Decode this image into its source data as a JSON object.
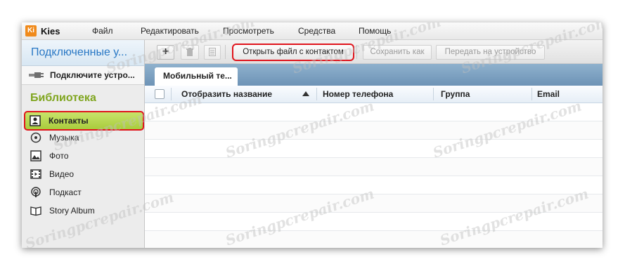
{
  "window": {
    "app_title": "Kies",
    "logo_text": "Ki"
  },
  "menu": [
    "Файл",
    "Редактировать",
    "Просмотреть",
    "Средства",
    "Помощь"
  ],
  "sidebar": {
    "connected_header": "Подключенные у...",
    "device_prompt": "Подключите устро...",
    "library_header": "Библиотека",
    "items": [
      {
        "label": "Контакты",
        "icon": "contacts-icon",
        "active": true
      },
      {
        "label": "Музыка",
        "icon": "music-icon",
        "active": false
      },
      {
        "label": "Фото",
        "icon": "photo-icon",
        "active": false
      },
      {
        "label": "Видео",
        "icon": "video-icon",
        "active": false
      },
      {
        "label": "Подкаст",
        "icon": "podcast-icon",
        "active": false
      },
      {
        "label": "Story Album",
        "icon": "book-icon",
        "active": false
      }
    ]
  },
  "toolbar": {
    "add_label": "+",
    "open_file_label": "Открыть файл с контактом",
    "save_as_label": "Сохранить как",
    "transfer_label": "Передать на устройство"
  },
  "tab": {
    "label": "Мобильный те..."
  },
  "table": {
    "columns": [
      "Отобразить название",
      "Номер телефона",
      "Группа",
      "Email"
    ],
    "sorted_column": "Отобразить название",
    "rows": []
  },
  "watermark": "Soringpcrepair.com",
  "colors": {
    "accent": "#2a78c5",
    "library": "#7fa51e",
    "highlight_border": "#e0141c",
    "active_item": "#b5d54a"
  }
}
